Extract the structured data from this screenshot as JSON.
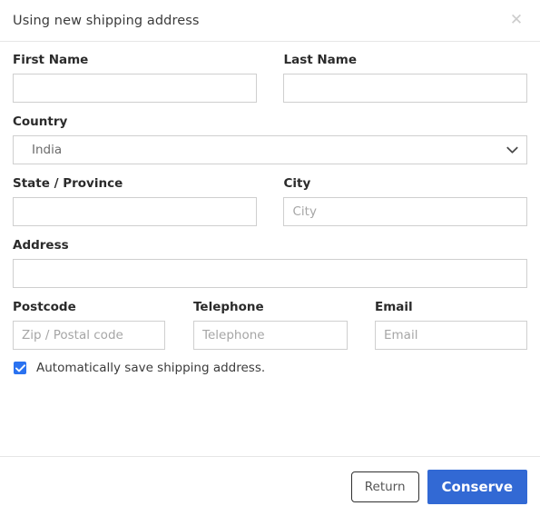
{
  "dialog": {
    "title": "Using new shipping address",
    "close_icon": "close-icon"
  },
  "form": {
    "first_name": {
      "label": "First Name",
      "value": "",
      "placeholder": ""
    },
    "last_name": {
      "label": "Last Name",
      "value": "",
      "placeholder": ""
    },
    "country": {
      "label": "Country",
      "value": "India",
      "options": [
        "India"
      ],
      "icon": "chevron-down-icon"
    },
    "state": {
      "label": "State / Province",
      "value": "",
      "placeholder": ""
    },
    "city": {
      "label": "City",
      "value": "",
      "placeholder": "City"
    },
    "address": {
      "label": "Address",
      "value": "",
      "placeholder": ""
    },
    "postcode": {
      "label": "Postcode",
      "value": "",
      "placeholder": "Zip / Postal code"
    },
    "telephone": {
      "label": "Telephone",
      "value": "",
      "placeholder": "Telephone"
    },
    "email": {
      "label": "Email",
      "value": "",
      "placeholder": "Email"
    },
    "autosave": {
      "label": "Automatically save shipping address.",
      "checked": true
    }
  },
  "footer": {
    "return_label": "Return",
    "conserve_label": "Conserve"
  },
  "colors": {
    "primary": "#3269d4",
    "checkbox": "#2a72f0",
    "border": "#cfcfcf",
    "divider": "#e6e6e6",
    "placeholder": "#a6a6a6"
  }
}
